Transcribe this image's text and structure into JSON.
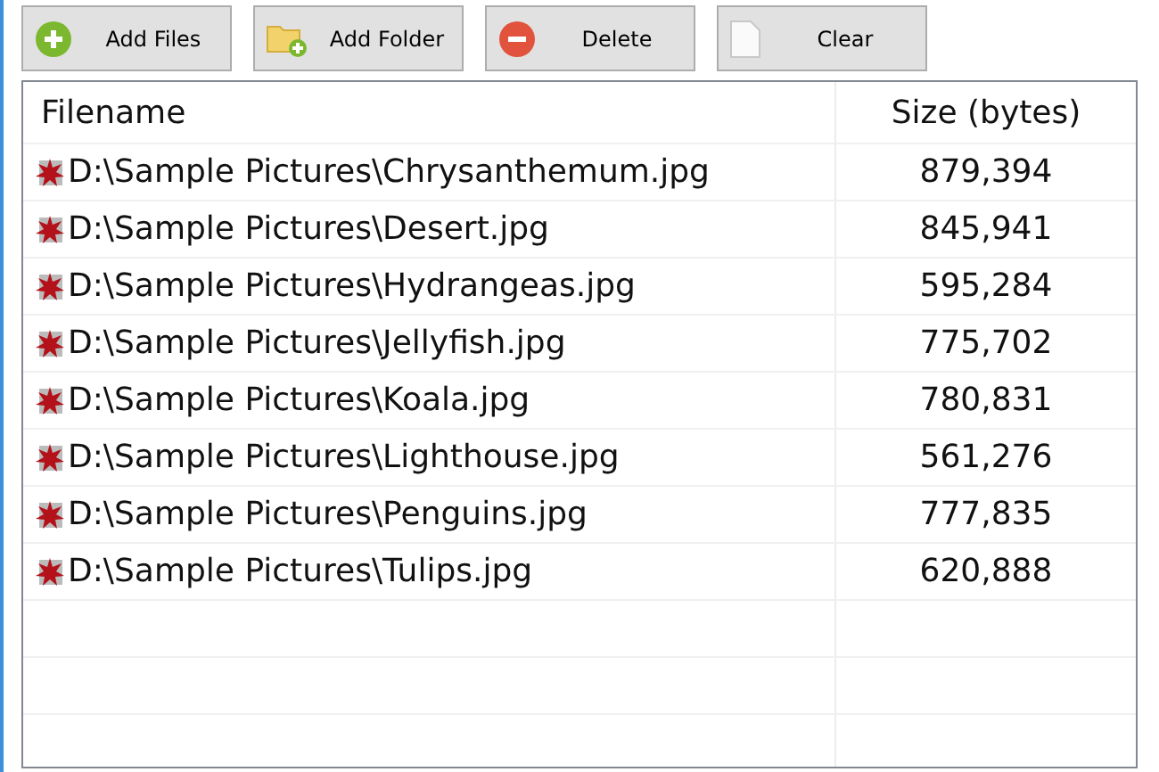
{
  "toolbar": [
    {
      "label": "Add Files",
      "kind": "add"
    },
    {
      "label": "Add Folder",
      "kind": "folder"
    },
    {
      "label": "Delete",
      "kind": "delete"
    },
    {
      "label": "Clear",
      "kind": "clear"
    }
  ],
  "table": {
    "columns": [
      "Filename",
      "Size (bytes)"
    ],
    "rows": [
      {
        "filename": "D:\\Sample Pictures\\Chrysanthemum.jpg",
        "size": "879,394"
      },
      {
        "filename": "D:\\Sample Pictures\\Desert.jpg",
        "size": "845,941"
      },
      {
        "filename": "D:\\Sample Pictures\\Hydrangeas.jpg",
        "size": "595,284"
      },
      {
        "filename": "D:\\Sample Pictures\\Jellyfish.jpg",
        "size": "775,702"
      },
      {
        "filename": "D:\\Sample Pictures\\Koala.jpg",
        "size": "780,831"
      },
      {
        "filename": "D:\\Sample Pictures\\Lighthouse.jpg",
        "size": "561,276"
      },
      {
        "filename": "D:\\Sample Pictures\\Penguins.jpg",
        "size": "777,835"
      },
      {
        "filename": "D:\\Sample Pictures\\Tulips.jpg",
        "size": "620,888"
      }
    ]
  }
}
